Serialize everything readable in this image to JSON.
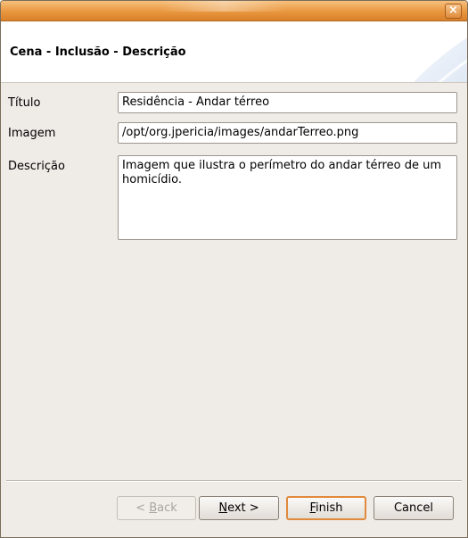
{
  "window": {
    "close_glyph": "×"
  },
  "header": {
    "title": "Cena - Inclusão - Descrição"
  },
  "form": {
    "titulo_label": "Título",
    "titulo_value": "Residência - Andar térreo",
    "imagem_label": "Imagem",
    "imagem_value": "/opt/org.jpericia/images/andarTerreo.png",
    "descricao_label": "Descrição",
    "descricao_value": "Imagem que ilustra o perímetro do andar térreo de um homicídio."
  },
  "buttons": {
    "back_prefix": "< ",
    "back_mnemonic": "B",
    "back_rest": "ack",
    "next_mnemonic": "N",
    "next_rest": "ext >",
    "finish_mnemonic": "F",
    "finish_rest": "inish",
    "cancel": "Cancel"
  },
  "colors": {
    "titlebar": "#e9973f",
    "window_bg": "#efebe7",
    "default_button_border": "#e08a3c"
  }
}
